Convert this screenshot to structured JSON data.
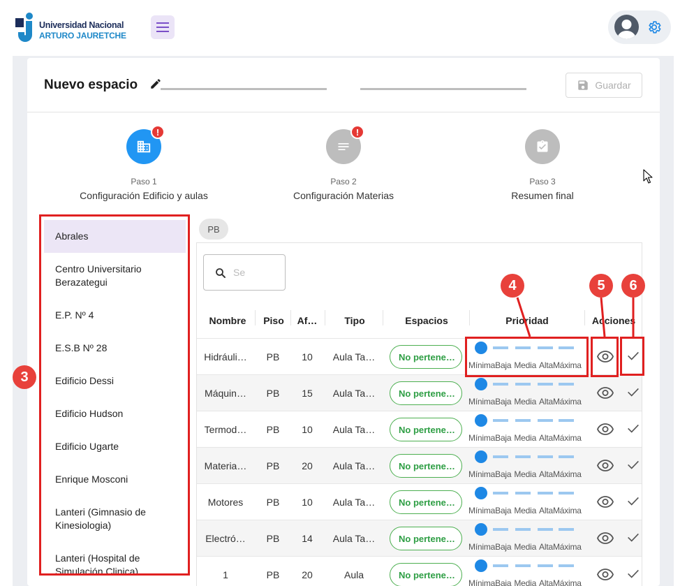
{
  "brand": {
    "line1": "Universidad Nacional",
    "line2": "ARTURO JAURETCHE"
  },
  "header": {
    "title": "Nuevo espacio",
    "save_label": "Guardar"
  },
  "steps": [
    {
      "num": "Paso 1",
      "name": "Configuración Edificio y aulas",
      "badge": "!",
      "color": "#2196f3"
    },
    {
      "num": "Paso 2",
      "name": "Configuración Materias",
      "badge": "!",
      "color": "#bdbdbd"
    },
    {
      "num": "Paso 3",
      "name": "Resumen final",
      "badge": "",
      "color": "#bdbdbd"
    }
  ],
  "buildings": [
    "Abrales",
    "Centro Universitario Berazategui",
    "E.P. Nº 4",
    "E.S.B Nº 28",
    "Edificio Dessi",
    "Edificio Hudson",
    "Edificio Ugarte",
    "Enrique Mosconi",
    "Lanteri (Gimnasio de Kinesiologia)",
    "Lanteri (Hospital de Simulación Clinica)"
  ],
  "floor_chip": "PB",
  "search": {
    "placeholder": "Se"
  },
  "columns": {
    "nombre": "Nombre",
    "piso": "Piso",
    "aforo": "Af…",
    "tipo": "Tipo",
    "espacios": "Espacios",
    "prioridad": "Prioridad",
    "acciones": "Acciones"
  },
  "priority_labels": [
    "Mínima",
    "Baja",
    "Media",
    "Alta",
    "Máxima"
  ],
  "rows": [
    {
      "nombre": "Hidráuli…",
      "piso": "PB",
      "aforo": "10",
      "tipo": "Aula Ta…",
      "espacios": "No pertene…",
      "priority": 0
    },
    {
      "nombre": "Máquin…",
      "piso": "PB",
      "aforo": "15",
      "tipo": "Aula Ta…",
      "espacios": "No pertene…",
      "priority": 0
    },
    {
      "nombre": "Termod…",
      "piso": "PB",
      "aforo": "10",
      "tipo": "Aula Ta…",
      "espacios": "No pertene…",
      "priority": 0
    },
    {
      "nombre": "Materia…",
      "piso": "PB",
      "aforo": "20",
      "tipo": "Aula Ta…",
      "espacios": "No pertene…",
      "priority": 0
    },
    {
      "nombre": "Motores",
      "piso": "PB",
      "aforo": "10",
      "tipo": "Aula Ta…",
      "espacios": "No pertene…",
      "priority": 0
    },
    {
      "nombre": "Electró…",
      "piso": "PB",
      "aforo": "14",
      "tipo": "Aula Ta…",
      "espacios": "No pertene…",
      "priority": 0
    },
    {
      "nombre": "1",
      "piso": "PB",
      "aforo": "20",
      "tipo": "Aula",
      "espacios": "No pertene…",
      "priority": 0
    }
  ],
  "annotations": [
    "3",
    "4",
    "5",
    "6"
  ],
  "icons": {
    "menu": "hamburger-icon",
    "settings": "gear-icon",
    "edit": "pencil-icon",
    "save": "floppy-icon",
    "view": "eye-icon",
    "select": "check-icon",
    "search": "search-icon"
  }
}
